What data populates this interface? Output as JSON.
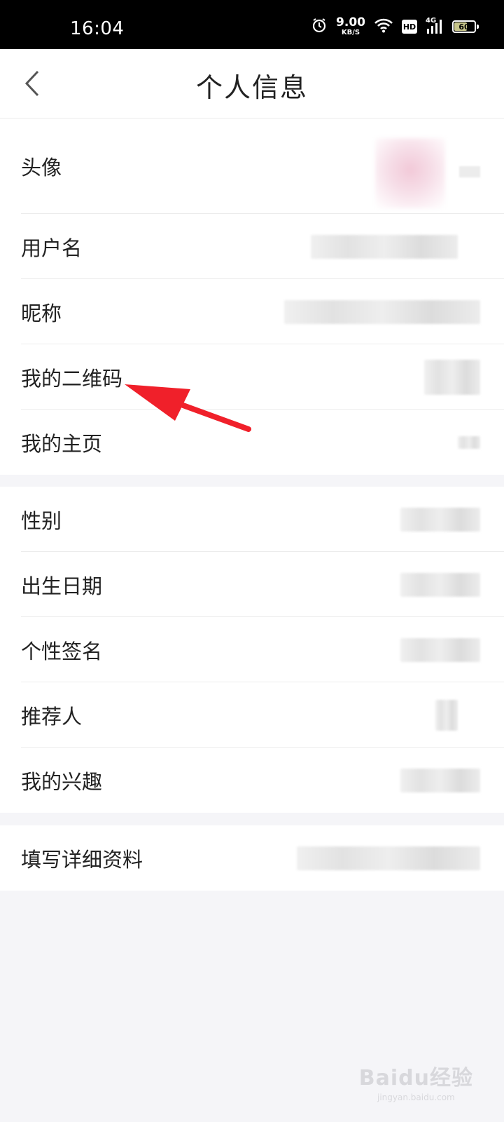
{
  "status_bar": {
    "time": "16:04",
    "net_speed": "9.00",
    "net_speed_unit": "KB/S",
    "hd_label": "HD",
    "signal_label": "4G",
    "battery_level": "60"
  },
  "header": {
    "title": "个人信息"
  },
  "groups": [
    {
      "items": [
        {
          "label": "头像"
        },
        {
          "label": "用户名"
        },
        {
          "label": "昵称"
        },
        {
          "label": "我的二维码"
        },
        {
          "label": "我的主页"
        }
      ]
    },
    {
      "items": [
        {
          "label": "性别"
        },
        {
          "label": "出生日期"
        },
        {
          "label": "个性签名"
        },
        {
          "label": "推荐人"
        },
        {
          "label": "我的兴趣"
        }
      ]
    },
    {
      "items": [
        {
          "label": "填写详细资料"
        }
      ]
    }
  ],
  "annotation": {
    "color": "#f0202a"
  },
  "watermark": {
    "logo": "Baidu经验",
    "sub": "jingyan.baidu.com"
  }
}
